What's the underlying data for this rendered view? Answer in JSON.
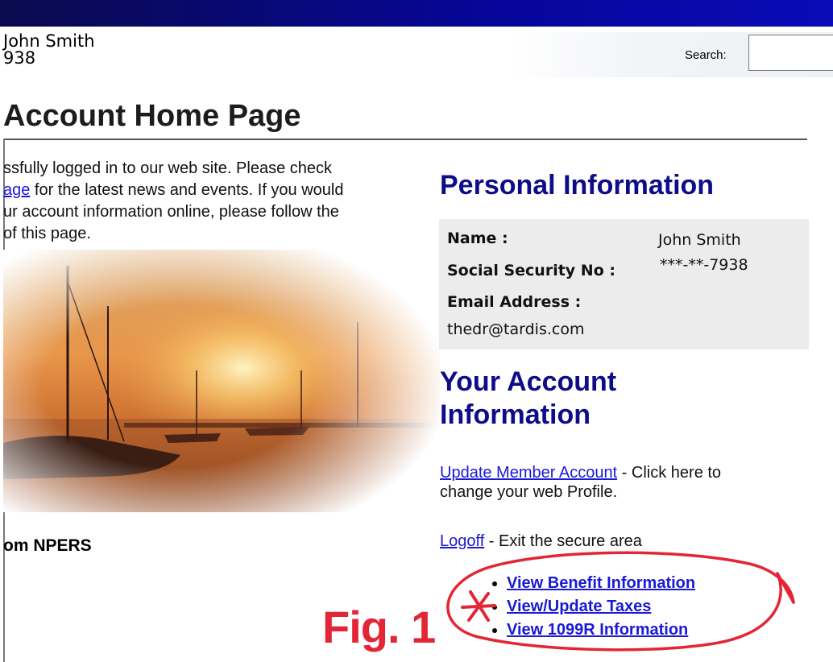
{
  "header": {
    "user_name": "John Smith",
    "user_id_fragment": "938",
    "search_label": "Search:",
    "search_value": ""
  },
  "page": {
    "title": "Account Home Page"
  },
  "intro": {
    "line1": "ssfully logged in to our web site. Please check",
    "link_text": "age",
    "line2_rest": " for the latest news and events. If you would",
    "line3": "ur account information online, please follow the",
    "line4": "of this page."
  },
  "left": {
    "from_npers": "om NPERS"
  },
  "personal_info": {
    "heading": "Personal Information",
    "name_label": "Name :",
    "name_value": "John Smith",
    "ssn_label": "Social Security No :",
    "ssn_value": "***-**-7938",
    "email_label": "Email Address :",
    "email_value": "thedr@tardis.com"
  },
  "account_info": {
    "heading_line1": "Your Account",
    "heading_line2": "Information",
    "update_link": "Update Member Account",
    "update_text_1": " - Click here to",
    "update_text_2": "change your web Profile.",
    "logoff_link": "Logoff",
    "logoff_text": " - Exit the secure area",
    "links": [
      "View Benefit Information",
      "View/Update Taxes",
      "View 1099R Information"
    ]
  },
  "annotation": {
    "figure_label": "Fig. 1",
    "color": "#e32636"
  }
}
